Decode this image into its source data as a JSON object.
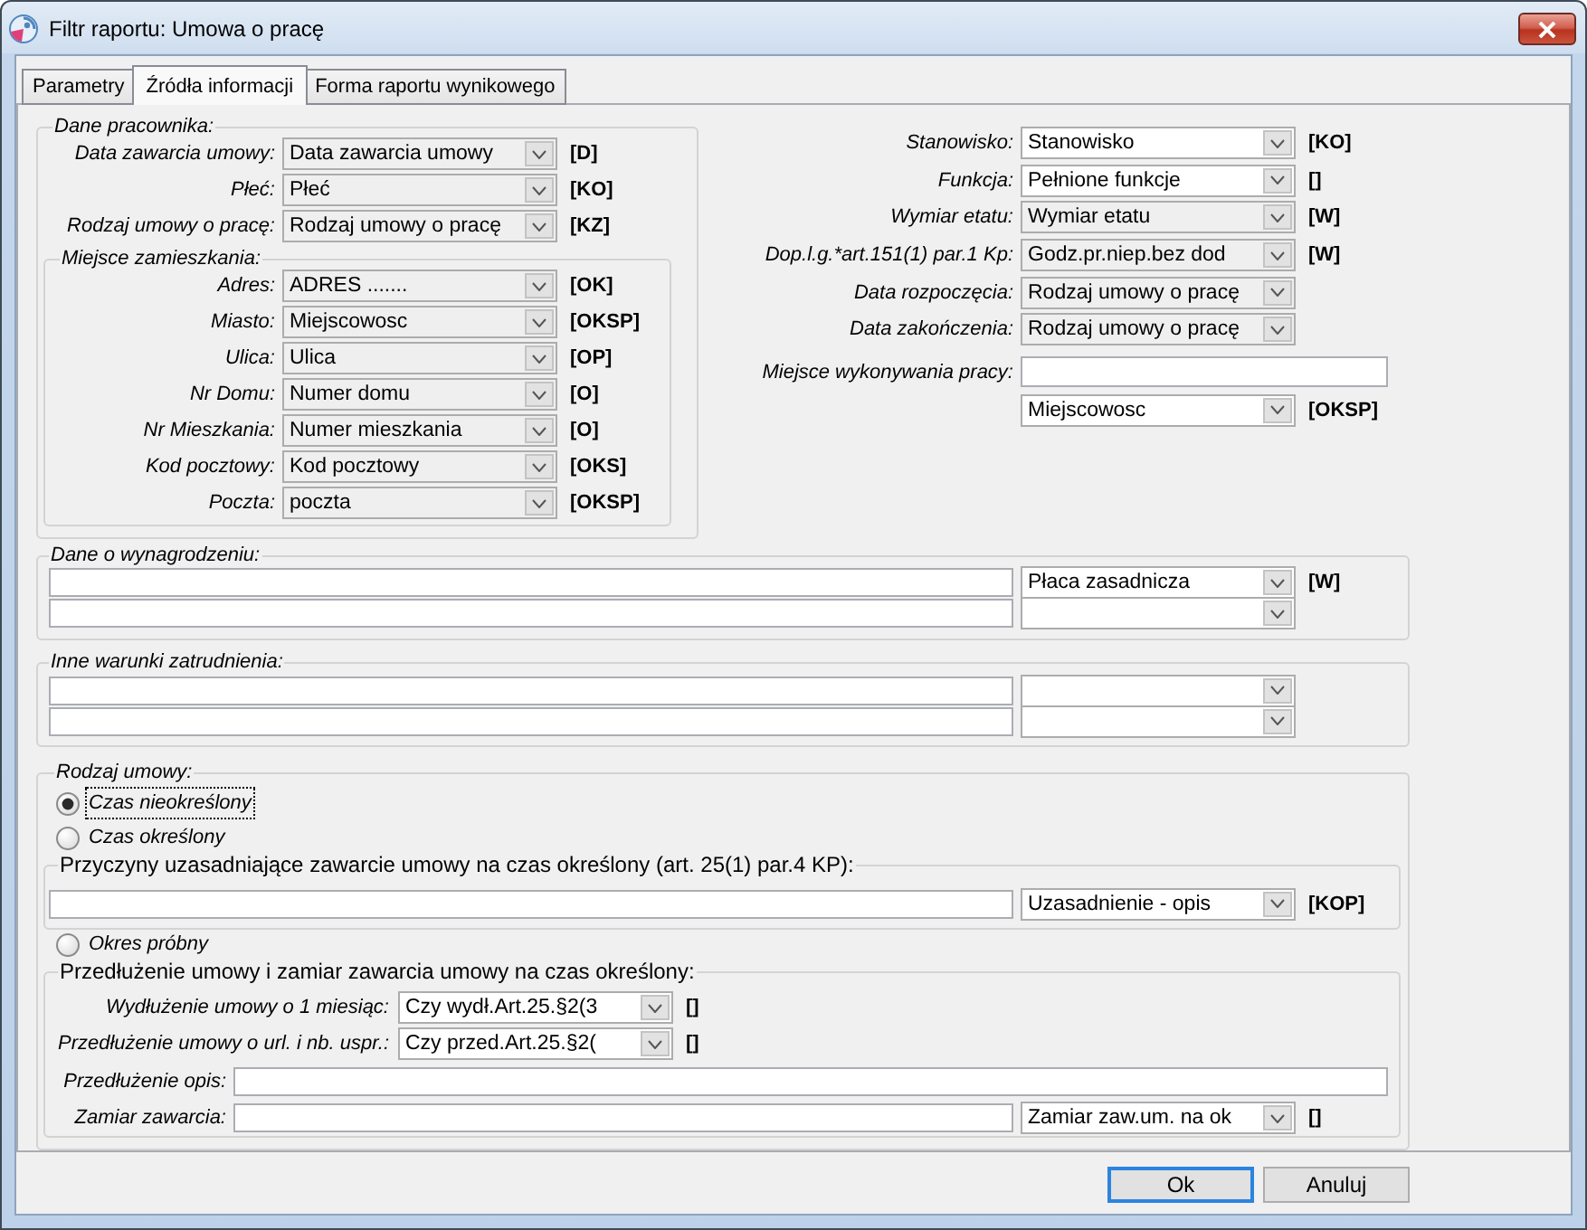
{
  "window": {
    "title": "Filtr raportu: Umowa o pracę"
  },
  "tabs": [
    {
      "label": "Parametry",
      "selected": false
    },
    {
      "label": "Źródła informacji",
      "selected": true
    },
    {
      "label": "Forma raportu wynikowego",
      "selected": false
    }
  ],
  "dane_pracownika": {
    "title": "Dane pracownika:",
    "fields": [
      {
        "label": "Data zawarcia umowy:",
        "value": "Data zawarcia umowy",
        "editable": false,
        "code": "[D]"
      },
      {
        "label": "Płeć:",
        "value": "Płeć",
        "editable": false,
        "code": "[KO]"
      },
      {
        "label": "Rodzaj umowy o pracę:",
        "value": "Rodzaj umowy o pracę",
        "editable": false,
        "code": "[KZ]"
      }
    ],
    "miejsce_zamieszkania": {
      "title": "Miejsce zamieszkania:",
      "fields": [
        {
          "label": "Adres:",
          "value": "ADRES .......",
          "editable": false,
          "code": "[OK]"
        },
        {
          "label": "Miasto:",
          "value": "Miejscowosc",
          "editable": false,
          "code": "[OKSP]"
        },
        {
          "label": "Ulica:",
          "value": "Ulica",
          "editable": false,
          "code": "[OP]"
        },
        {
          "label": "Nr Domu:",
          "value": "Numer domu",
          "editable": false,
          "code": "[O]"
        },
        {
          "label": "Nr Mieszkania:",
          "value": "Numer mieszkania",
          "editable": false,
          "code": "[O]"
        },
        {
          "label": "Kod pocztowy:",
          "value": "Kod pocztowy",
          "editable": false,
          "code": "[OKS]"
        },
        {
          "label": "Poczta:",
          "value": "poczta",
          "editable": false,
          "code": "[OKSP]"
        }
      ]
    }
  },
  "stanowisko_fields": [
    {
      "label": "Stanowisko:",
      "value": "Stanowisko",
      "editable": true,
      "code": "[KO]"
    },
    {
      "label": "Funkcja:",
      "value": "Pełnione funkcje",
      "editable": true,
      "code": "[]"
    },
    {
      "label": "Wymiar etatu:",
      "value": "Wymiar etatu",
      "editable": false,
      "code": "[W]"
    },
    {
      "label": "Dop.l.g.*art.151(1) par.1 Kp:",
      "value": "Godz.pr.niep.bez dod",
      "editable": false,
      "code": "[W]"
    },
    {
      "label": "Data rozpoczęcia:",
      "value": "Rodzaj umowy o pracę",
      "editable": false
    },
    {
      "label": "Data zakończenia:",
      "value": "Rodzaj umowy o pracę",
      "editable": false
    }
  ],
  "miejsce_wykonywania_pracy": {
    "label": "Miejsce wykonywania pracy:",
    "value": "Miejscowosc",
    "editable": true,
    "code": "[OKSP]"
  },
  "dane_o_wynagrodzeniu": {
    "title": "Dane o wynagrodzeniu:",
    "rows": [
      {
        "value": "Płaca zasadnicza",
        "editable": true,
        "code": "[W]"
      },
      {
        "editable": true
      }
    ]
  },
  "inne_warunki_zatrudnienia": {
    "title": "Inne warunki zatrudnienia:",
    "rows": [
      {
        "editable": true
      },
      {
        "editable": true
      }
    ]
  },
  "rodzaj_umowy": {
    "title": "Rodzaj umowy:",
    "items": [
      {
        "kind": "radio",
        "label": "Czas nieokreślony",
        "selected": true,
        "focused": true
      },
      {
        "kind": "radio",
        "label": "Czas określony",
        "selected": false,
        "focused": false
      },
      {
        "kind": "group",
        "title": "Przyczyny uzasadniające zawarcie umowy na czas określony (art. 25(1) par.4 KP):",
        "rows": [
          {
            "kind": "text_combo",
            "value": "Uzasadnienie - opis",
            "editable": true,
            "code": "[KOP]"
          }
        ]
      },
      {
        "kind": "radio",
        "label": "Okres próbny",
        "selected": false,
        "focused": false
      },
      {
        "kind": "group",
        "title": "Przedłużenie umowy i zamiar zawarcia umowy na czas określony:",
        "rows": [
          {
            "kind": "combo",
            "label": "Wydłużenie umowy o 1 miesiąc:",
            "value": "Czy wydł.Art.25.§2(3",
            "editable": true,
            "code": "[]"
          },
          {
            "kind": "combo",
            "label": "Przedłużenie umowy o url. i nb. uspr.:",
            "value": "Czy przed.Art.25.§2(",
            "editable": true,
            "code": "[]"
          },
          {
            "kind": "text",
            "label": "Przedłużenie opis:"
          },
          {
            "kind": "text_combo",
            "label": "Zamiar zawarcia:",
            "value": "Zamiar zaw.um. na ok",
            "editable": true,
            "code": "[]"
          }
        ]
      }
    ]
  },
  "buttons": [
    {
      "label": "Ok",
      "default": true
    },
    {
      "label": "Anuluj",
      "default": false
    }
  ]
}
